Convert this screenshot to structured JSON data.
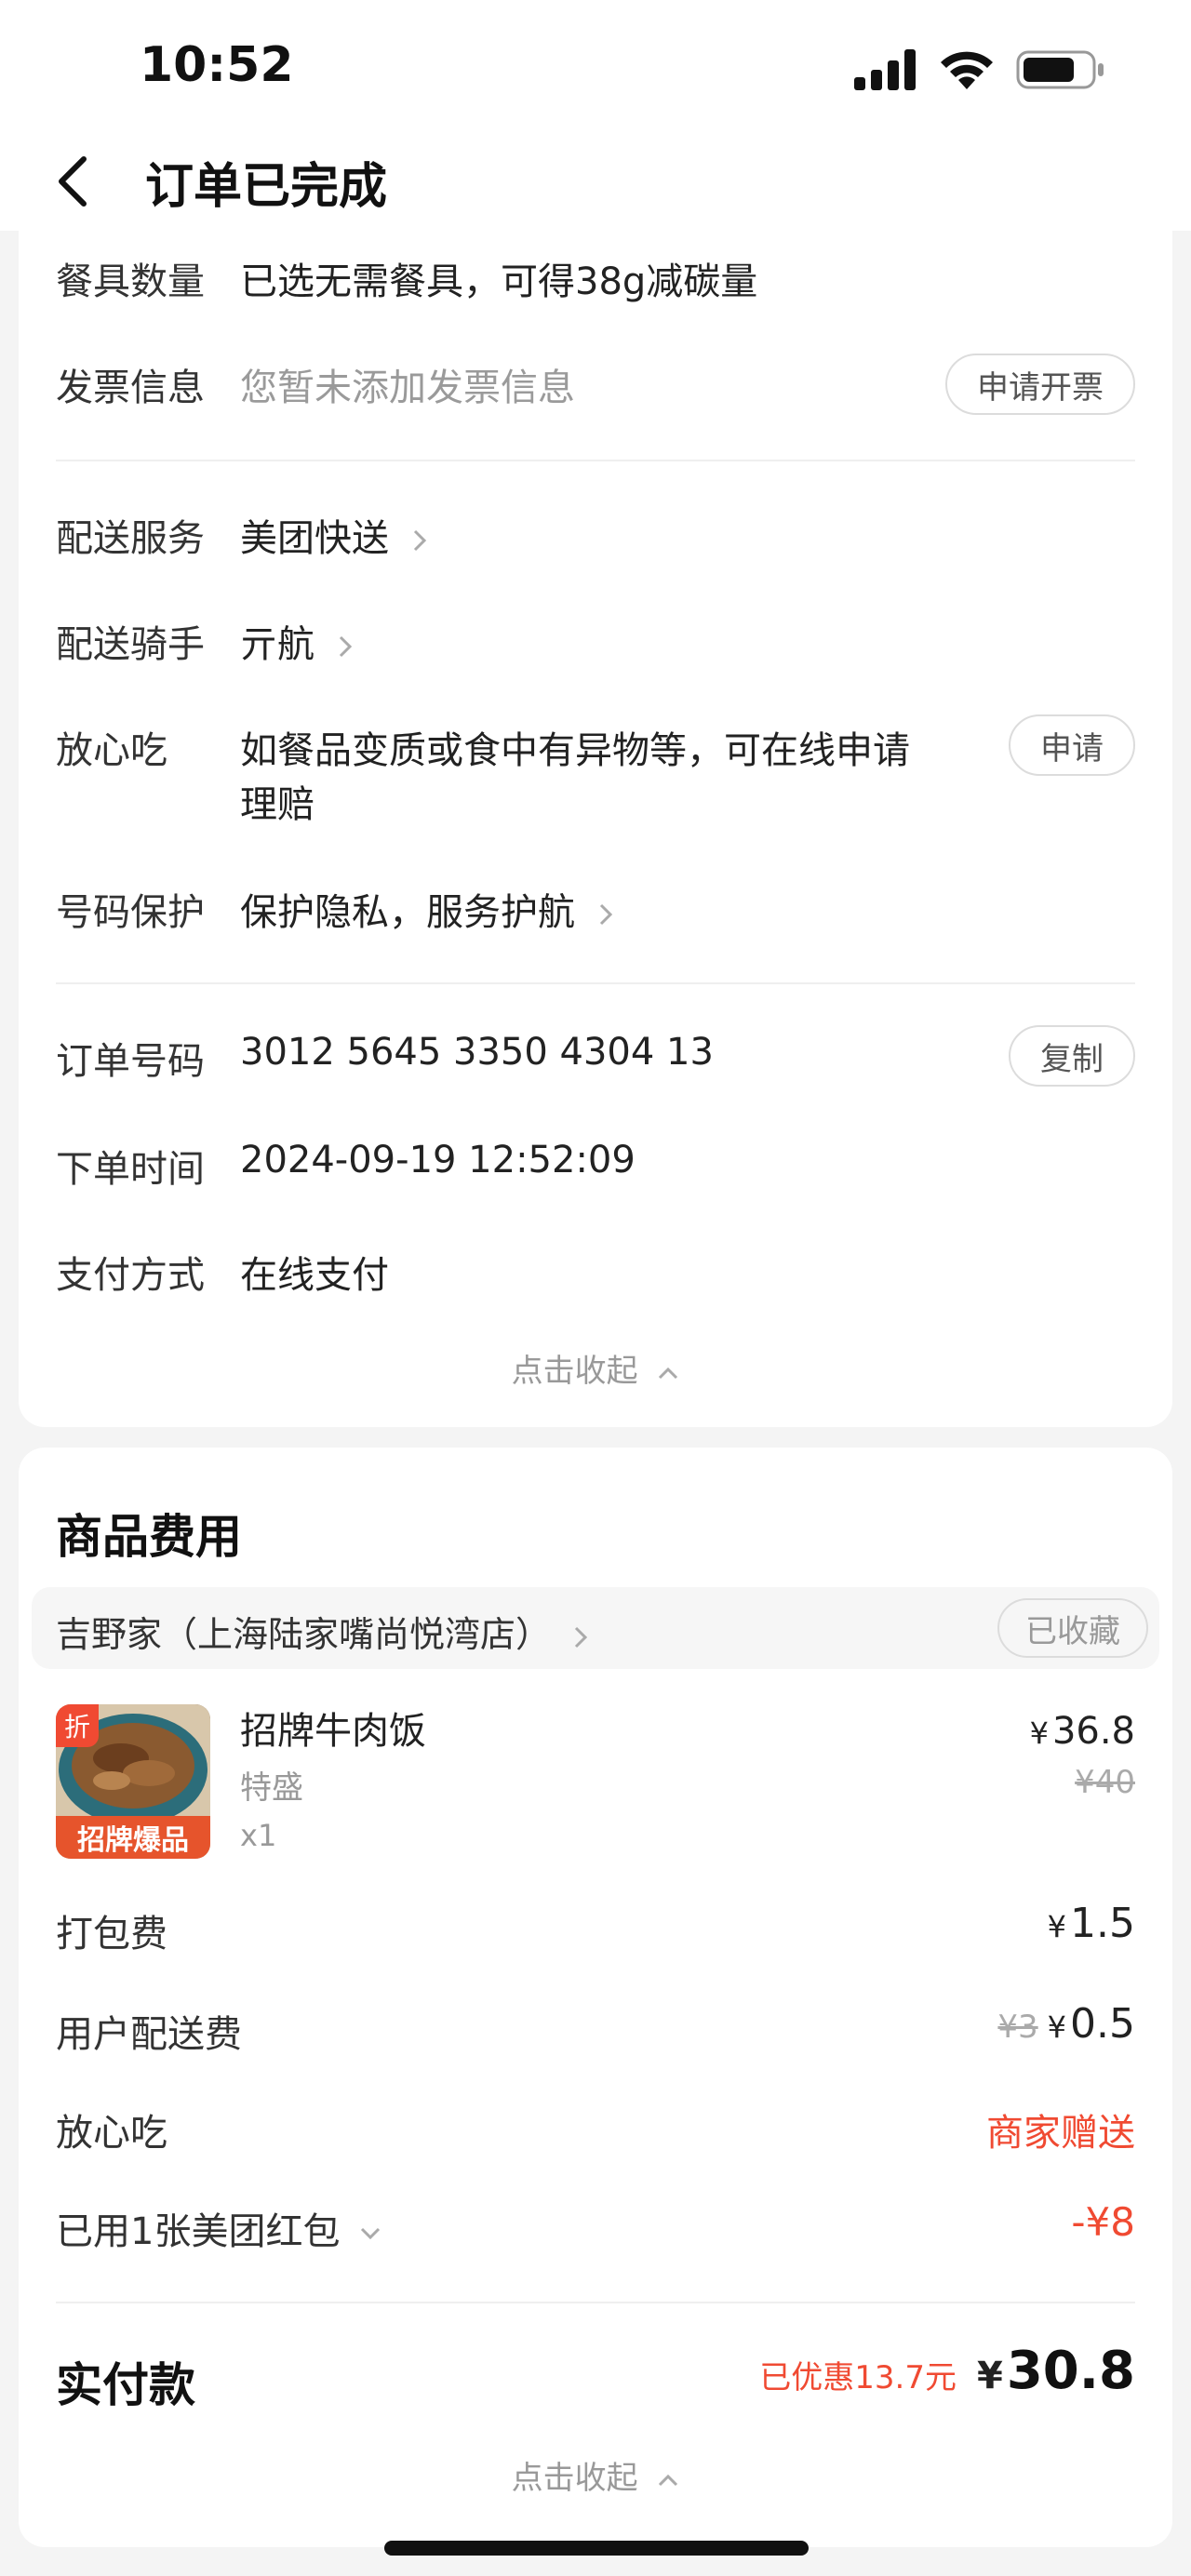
{
  "status_bar": {
    "time": "10:52"
  },
  "nav": {
    "title": "订单已完成"
  },
  "order_info": {
    "tableware": {
      "label": "餐具数量",
      "value": "已选无需餐具，可得38g减碳量"
    },
    "invoice": {
      "label": "发票信息",
      "value": "您暂未添加发票信息",
      "button": "申请开票"
    },
    "delivery_service": {
      "label": "配送服务",
      "value": "美团快送"
    },
    "rider": {
      "label": "配送骑手",
      "value": "亓航"
    },
    "worry_free": {
      "label": "放心吃",
      "value_line1": "如餐品变质或食中有异物等，可在线申请",
      "value_line2": "理赔",
      "button": "申请"
    },
    "number_protect": {
      "label": "号码保护",
      "value": "保护隐私，服务护航"
    },
    "order_no": {
      "label": "订单号码",
      "value": "3012 5645 3350 4304 13",
      "button": "复制"
    },
    "order_time": {
      "label": "下单时间",
      "value": "2024-09-19 12:52:09"
    },
    "payment": {
      "label": "支付方式",
      "value": "在线支付"
    },
    "collapse": "点击收起"
  },
  "costs": {
    "title": "商品费用",
    "store": {
      "name": "吉野家（上海陆家嘴尚悦湾店）",
      "favorite": "已收藏"
    },
    "item": {
      "badge": "折",
      "image_caption": "招牌爆品",
      "name": "招牌牛肉饭",
      "spec": "特盛",
      "qty": "x1",
      "currency": "¥",
      "price": "36.8",
      "original_price": "¥40"
    },
    "packing": {
      "label": "打包费",
      "currency": "¥",
      "value": "1.5"
    },
    "delivery_fee": {
      "label": "用户配送费",
      "original": "¥3",
      "currency": "¥",
      "value": "0.5"
    },
    "worry_free": {
      "label": "放心吃",
      "value": "商家赠送"
    },
    "redpacket": {
      "label": "已用1张美团红包",
      "value": "-¥8"
    },
    "total": {
      "label": "实付款",
      "discount": "已优惠13.7元",
      "currency": "¥",
      "value": "30.8"
    },
    "collapse": "点击收起"
  },
  "colors": {
    "accent_red": "#f04a32",
    "text_gray": "#9a9a9a"
  }
}
